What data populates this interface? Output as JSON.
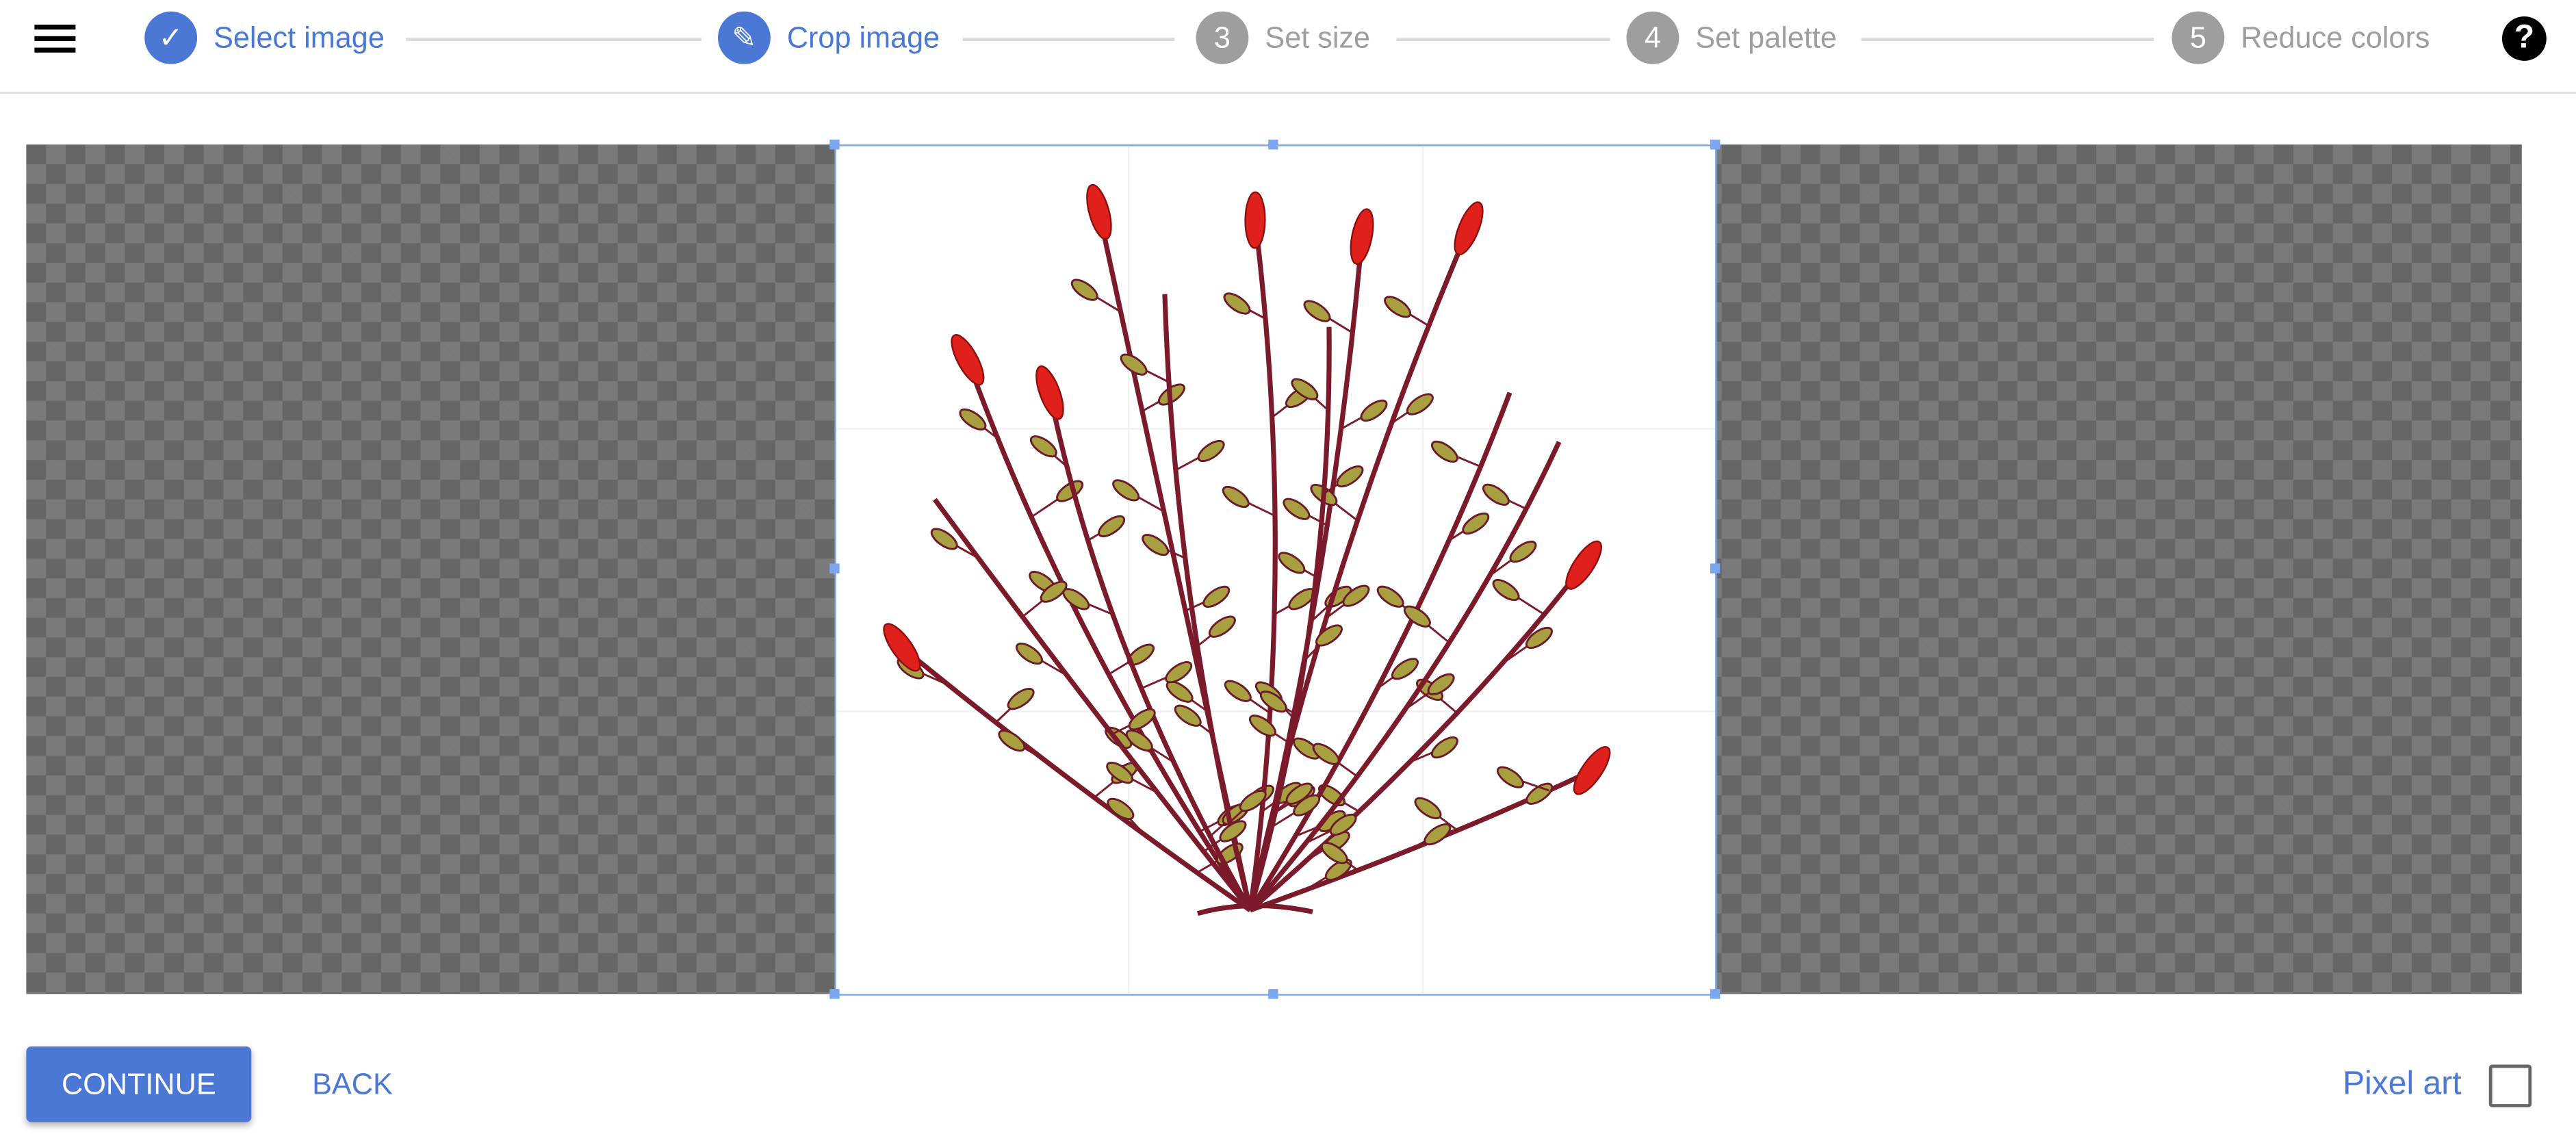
{
  "header": {
    "menu_icon": "hamburger-icon",
    "help_icon": "question-mark-icon",
    "steps": [
      {
        "label": "Select image",
        "marker": "✓",
        "state": "done"
      },
      {
        "label": "Crop image",
        "marker": "✎",
        "state": "active"
      },
      {
        "label": "Set size",
        "marker": "3",
        "state": "pending"
      },
      {
        "label": "Set palette",
        "marker": "4",
        "state": "pending"
      },
      {
        "label": "Reduce colors",
        "marker": "5",
        "state": "pending"
      }
    ]
  },
  "footer": {
    "continue_label": "CONTINUE",
    "back_label": "BACK",
    "pixel_art_label": "Pixel art",
    "pixel_art_checked": false
  },
  "colors": {
    "accent": "#4a78d4",
    "pending": "#9e9e9e",
    "crop_border": "#7aa7f0"
  }
}
